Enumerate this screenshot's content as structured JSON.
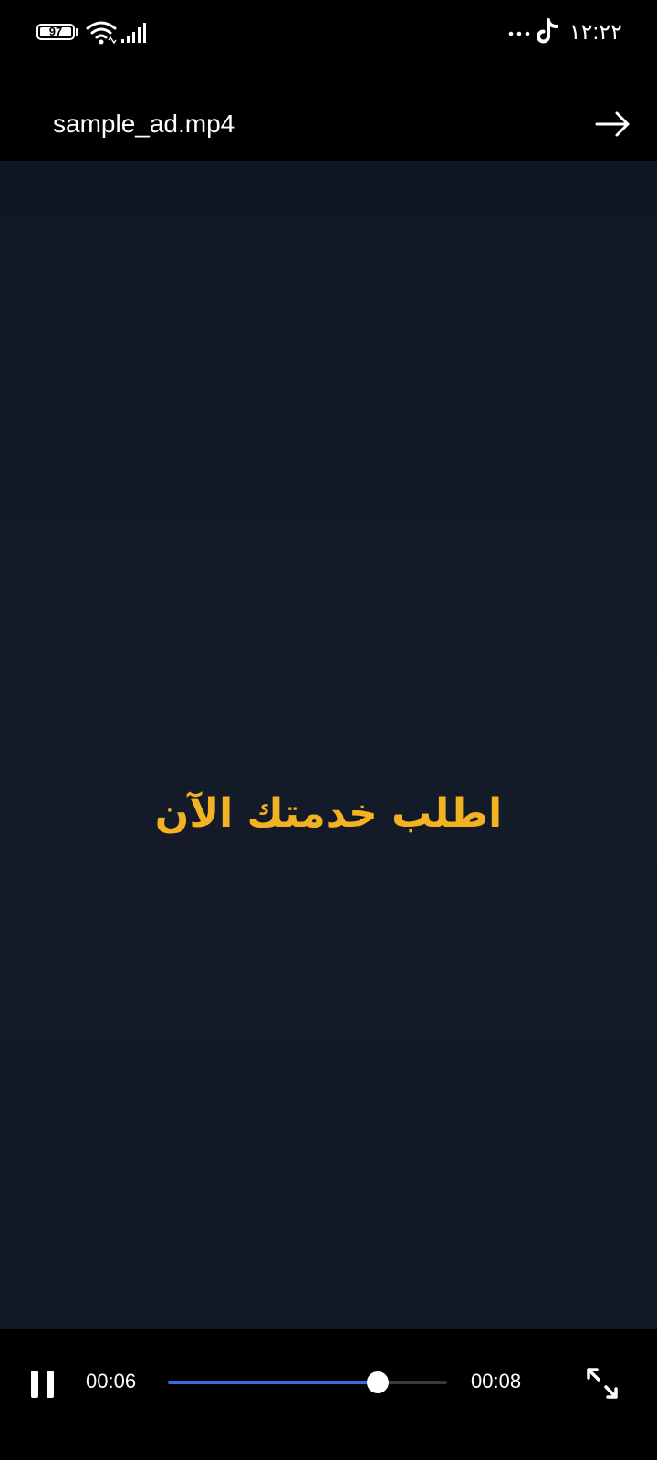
{
  "status_bar": {
    "battery_level": "97",
    "clock": "١٢:٢٢",
    "icons": [
      "battery-icon",
      "wifi-icon",
      "signal-icon",
      "more-icon",
      "tiktok-icon"
    ]
  },
  "header": {
    "title": "sample_ad.mp4",
    "forward_icon": "arrow-right-icon"
  },
  "video": {
    "caption": "اطلب خدمتك الآن",
    "caption_color": "#f2b222",
    "background_color": "#131a26"
  },
  "controls": {
    "pause_icon": "pause-icon",
    "current_time": "00:06",
    "total_time": "00:08",
    "progress_percent": 75,
    "progress_color": "#2f6fe0",
    "fullscreen_icon": "fullscreen-icon"
  }
}
